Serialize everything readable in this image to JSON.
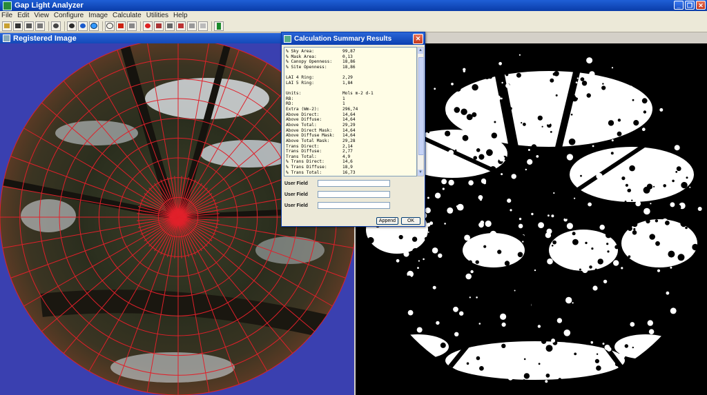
{
  "app": {
    "title": "Gap Light Analyzer",
    "window_buttons": [
      "_",
      "❐",
      "✕"
    ]
  },
  "menu": [
    "File",
    "Edit",
    "View",
    "Configure",
    "Image",
    "Calculate",
    "Utilities",
    "Help"
  ],
  "toolbar_icons": [
    "open-icon",
    "save-icon",
    "print-icon",
    "copy-icon",
    "undo-icon",
    "register-icon",
    "threshold-icon",
    "blue-circle-icon",
    "zoom-icon",
    "sky-region-icon",
    "mask-icon",
    "grid-icon",
    "calculate-icon",
    "report-icon",
    "orbit-icon",
    "angle-icon",
    "text-icon",
    "exit-icon"
  ],
  "left_window": {
    "title": "Registered Image"
  },
  "dialog": {
    "title": "Calculation Summary Results",
    "close": "✕",
    "rows": [
      {
        "k": "% Sky Area:",
        "v": "99,87"
      },
      {
        "k": "% Mask Area:",
        "v": "0,13"
      },
      {
        "k": "% Canopy Openness:",
        "v": "18,86"
      },
      {
        "k": "% Site Openness:",
        "v": "18,86"
      },
      {
        "k": "",
        "v": ""
      },
      {
        "k": "LAI 4 Ring:",
        "v": "2,29"
      },
      {
        "k": "LAI 5 Ring:",
        "v": "1,84"
      },
      {
        "k": "",
        "v": ""
      },
      {
        "k": "Units:",
        "v": "Mols m-2 d-1"
      },
      {
        "k": "RB:",
        "v": "1"
      },
      {
        "k": "RD:",
        "v": "1"
      },
      {
        "k": "Extra (Wm-2):",
        "v": "296,74"
      },
      {
        "k": "Above Direct:",
        "v": "14,64"
      },
      {
        "k": "Above Diffuse:",
        "v": "14,64"
      },
      {
        "k": "Above Total:",
        "v": "29,29"
      },
      {
        "k": "Above Direct Mask:",
        "v": "14,64"
      },
      {
        "k": "Above Diffuse Mask:",
        "v": "14,64"
      },
      {
        "k": "Above Total Mask:",
        "v": "29,28"
      },
      {
        "k": "Trans Direct:",
        "v": "2,14"
      },
      {
        "k": "Trans Diffuse:",
        "v": "2,77"
      },
      {
        "k": "Trans Total:",
        "v": "4,9"
      },
      {
        "k": "% Trans Direct:",
        "v": "14,6"
      },
      {
        "k": "% Trans Diffuse:",
        "v": "18,9"
      },
      {
        "k": "% Trans Total:",
        "v": "16,73"
      }
    ],
    "user_fields": [
      {
        "label": "User Field",
        "value": ""
      },
      {
        "label": "User Field",
        "value": ""
      },
      {
        "label": "User Field",
        "value": ""
      }
    ],
    "append_label": "Append",
    "ok_label": "OK"
  },
  "colors": {
    "left_background": "#3a40b0",
    "grid_line": "#e0202a",
    "title_blue": "#0a3ca8"
  }
}
